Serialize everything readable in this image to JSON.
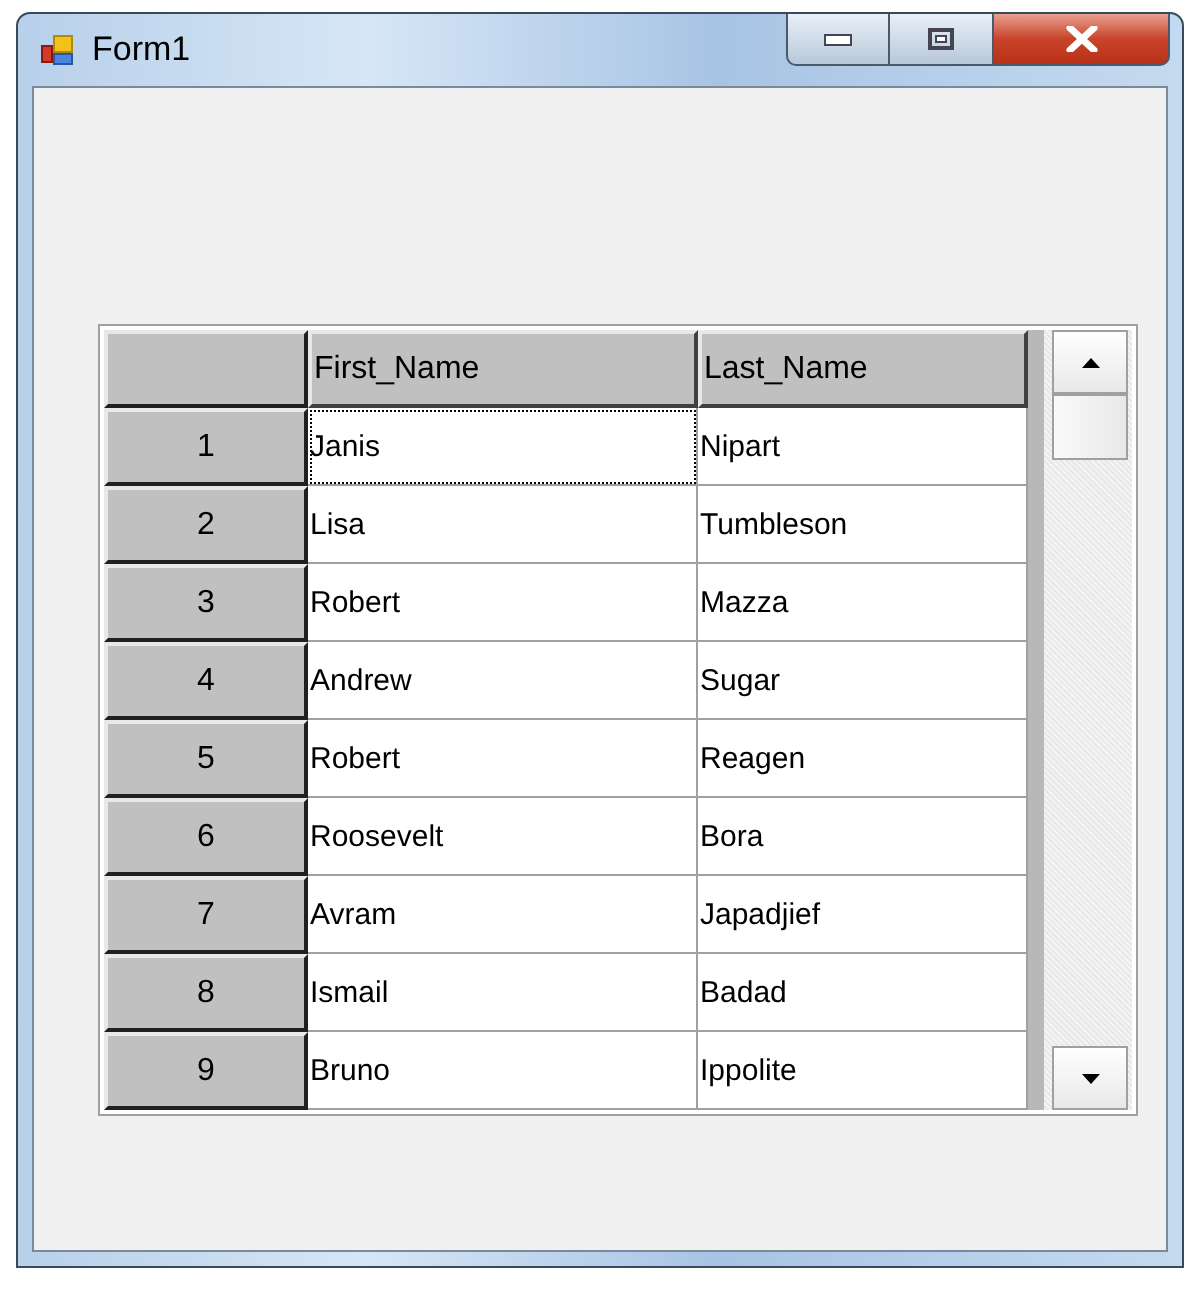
{
  "window": {
    "title": "Form1"
  },
  "grid": {
    "columns": [
      "First_Name",
      "Last_Name"
    ],
    "rows": [
      {
        "header": "1",
        "cells": [
          {
            "text": "Janis",
            "focused": true
          },
          {
            "text": "Nipart",
            "focused": false
          }
        ]
      },
      {
        "header": "2",
        "cells": [
          {
            "text": "Lisa",
            "focused": false
          },
          {
            "text": "Tumbleson",
            "focused": false
          }
        ]
      },
      {
        "header": "3",
        "cells": [
          {
            "text": "Robert",
            "focused": false
          },
          {
            "text": "Mazza",
            "focused": false
          }
        ]
      },
      {
        "header": "4",
        "cells": [
          {
            "text": "Andrew",
            "focused": false
          },
          {
            "text": "Sugar",
            "focused": false
          }
        ]
      },
      {
        "header": "5",
        "cells": [
          {
            "text": "Robert",
            "focused": false
          },
          {
            "text": "Reagen",
            "focused": false
          }
        ]
      },
      {
        "header": "6",
        "cells": [
          {
            "text": "Roosevelt",
            "focused": false
          },
          {
            "text": "Bora",
            "focused": false
          }
        ]
      },
      {
        "header": "7",
        "cells": [
          {
            "text": "Avram",
            "focused": false
          },
          {
            "text": "Japadjief",
            "focused": false
          }
        ]
      },
      {
        "header": "8",
        "cells": [
          {
            "text": "Ismail",
            "focused": false
          },
          {
            "text": "Badad",
            "focused": false
          }
        ]
      },
      {
        "header": "9",
        "cells": [
          {
            "text": "Bruno",
            "focused": false
          },
          {
            "text": "Ippolite",
            "focused": false
          }
        ]
      }
    ]
  }
}
